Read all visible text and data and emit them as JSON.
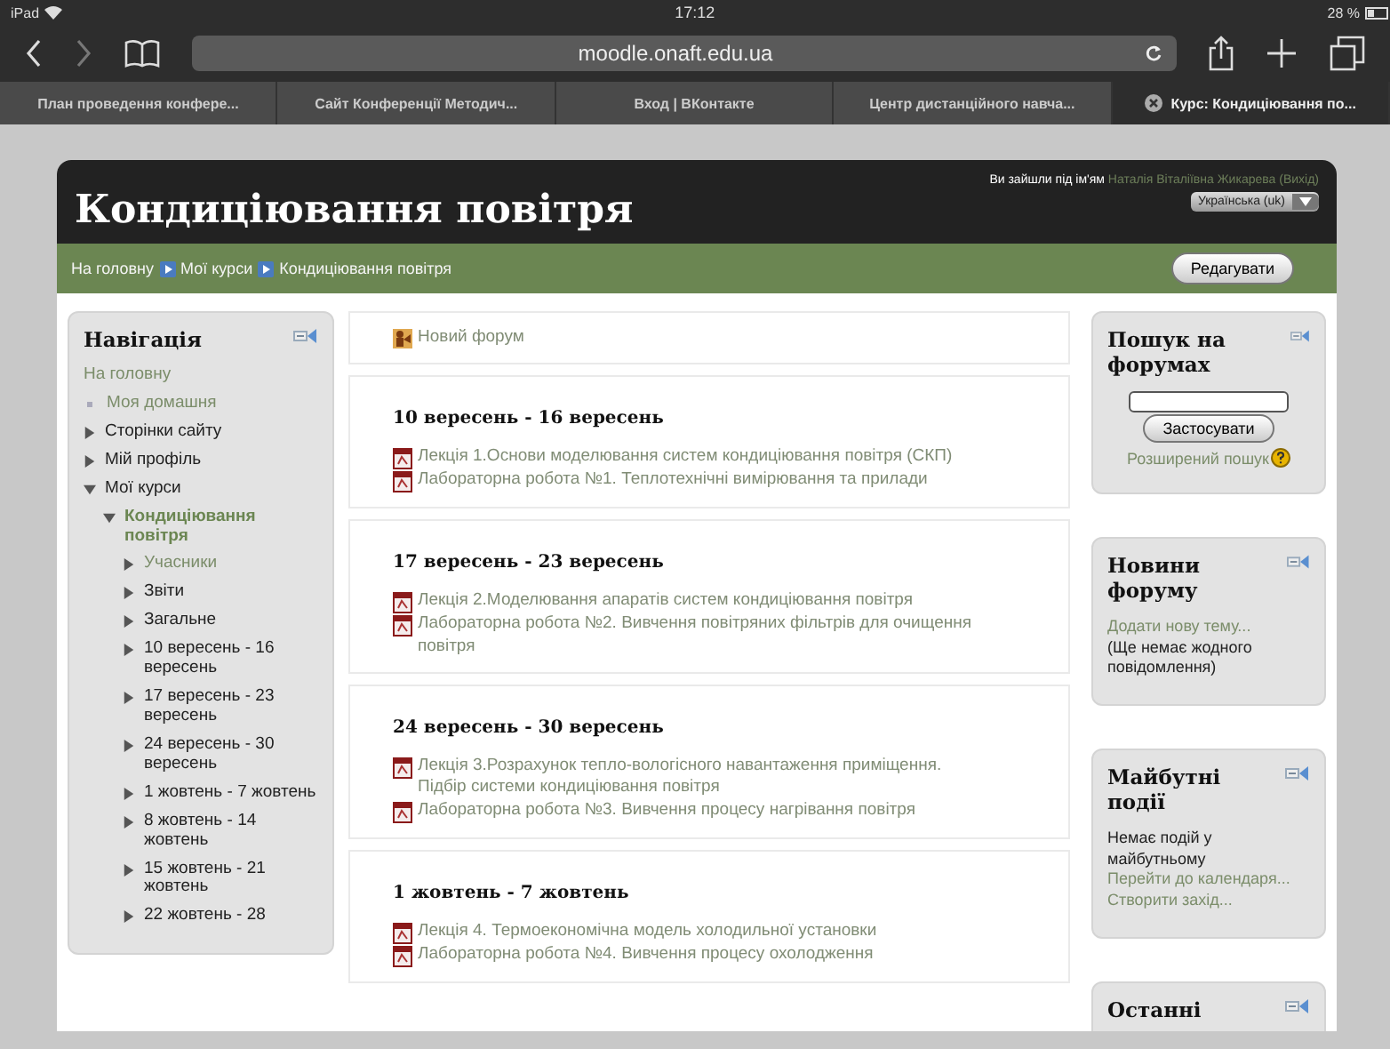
{
  "status_bar": {
    "device": "iPad",
    "time": "17:12",
    "battery": "28 %"
  },
  "browser": {
    "url": "moodle.onaft.edu.ua",
    "tabs": [
      {
        "label": "План проведення конфере...",
        "selected": false
      },
      {
        "label": "Сайт Конференції Методич...",
        "selected": false
      },
      {
        "label": "Вход | ВКонтакте",
        "selected": false
      },
      {
        "label": "Центр дистанційного навча...",
        "selected": false
      },
      {
        "label": "Курс: Кондиціювання по...",
        "selected": true
      }
    ]
  },
  "header": {
    "title": "Кондиціювання повітря",
    "login_prefix": "Ви зайшли під ім'ям",
    "user": "Наталія Віталіївна Жикарева",
    "logout": "(Вихід)",
    "language": "Українська (uk)"
  },
  "breadcrumb": [
    "На головну",
    "Мої курси",
    "Кондиціювання повітря"
  ],
  "edit_button": "Редагувати",
  "navigation": {
    "title": "Навігація",
    "items": [
      {
        "label": "На головну",
        "kind": "link"
      },
      {
        "label": "Моя домашня",
        "kind": "bullet"
      },
      {
        "label": "Сторінки сайту",
        "kind": "branch",
        "expanded": false
      },
      {
        "label": "Мій профіль",
        "kind": "branch",
        "expanded": false
      },
      {
        "label": "Мої курси",
        "kind": "branch",
        "expanded": true,
        "children": [
          {
            "label": "Кондиціювання повітря",
            "kind": "current",
            "expanded": true,
            "children": [
              {
                "label": "Учасники",
                "kind": "branch-link",
                "expanded": false
              },
              {
                "label": "Звіти",
                "kind": "branch",
                "expanded": false
              },
              {
                "label": "Загальне",
                "kind": "branch",
                "expanded": false
              },
              {
                "label": "10 вересень - 16 вересень",
                "kind": "branch",
                "expanded": false
              },
              {
                "label": "17 вересень - 23 вересень",
                "kind": "branch",
                "expanded": false
              },
              {
                "label": "24 вересень - 30 вересень",
                "kind": "branch",
                "expanded": false
              },
              {
                "label": "1 жовтень - 7 жовтень",
                "kind": "branch",
                "expanded": false
              },
              {
                "label": "8 жовтень - 14 жовтень",
                "kind": "branch",
                "expanded": false
              },
              {
                "label": "15 жовтень - 21 жовтень",
                "kind": "branch",
                "expanded": false
              },
              {
                "label": "22 жовтень - 28",
                "kind": "branch",
                "expanded": false
              }
            ]
          }
        ]
      }
    ]
  },
  "sections": [
    {
      "resources": [
        {
          "kind": "forum",
          "label": "Новий форум"
        }
      ]
    },
    {
      "title": "10 вересень - 16 вересень",
      "resources": [
        {
          "kind": "pdf",
          "label": "Лекція 1.Основи моделювання систем кондиціювання повітря (СКП)"
        },
        {
          "kind": "pdf",
          "label": "Лабораторна робота №1. Теплотехнічні вимірювання та прилади"
        }
      ]
    },
    {
      "title": "17 вересень - 23 вересень",
      "resources": [
        {
          "kind": "pdf",
          "label": "Лекція 2.Моделювання апаратів систем кондиціювання повітря"
        },
        {
          "kind": "pdf",
          "label": "Лабораторна робота №2. Вивчення повітряних фільтрів для очищення повітря"
        }
      ]
    },
    {
      "title": "24 вересень - 30 вересень",
      "resources": [
        {
          "kind": "pdf",
          "label": "Лекція 3.Розрахунок тепло-вологісного навантаження приміщення. Підбір системи кондиціювання повітря"
        },
        {
          "kind": "pdf",
          "label": "Лабораторна робота №3. Вивчення процесу нагрівання повітря"
        }
      ]
    },
    {
      "title": "1 жовтень - 7 жовтень",
      "resources": [
        {
          "kind": "pdf",
          "label": "Лекція 4. Термоекономічна модель холодильної установки"
        },
        {
          "kind": "pdf",
          "label": "Лабораторна робота №4. Вивчення процесу охолодження"
        }
      ]
    }
  ],
  "blocks": [
    {
      "title": "Пошук на форумах",
      "items": [
        {
          "kind": "search",
          "button": "Застосувати"
        },
        {
          "kind": "help-link",
          "label": "Розширений пошук"
        }
      ]
    },
    {
      "title": "Новини форуму",
      "items": [
        {
          "kind": "link",
          "label": "Додати нову тему..."
        },
        {
          "kind": "text",
          "label": "(Ще немає жодного повідомлення)"
        }
      ]
    },
    {
      "title": "Майбутні події",
      "items": [
        {
          "kind": "text",
          "label": "Немає подій у майбутньому"
        },
        {
          "kind": "link",
          "label": "Перейти до календаря..."
        },
        {
          "kind": "link",
          "label": "Створити захід..."
        }
      ]
    },
    {
      "title": "Останні"
    }
  ]
}
